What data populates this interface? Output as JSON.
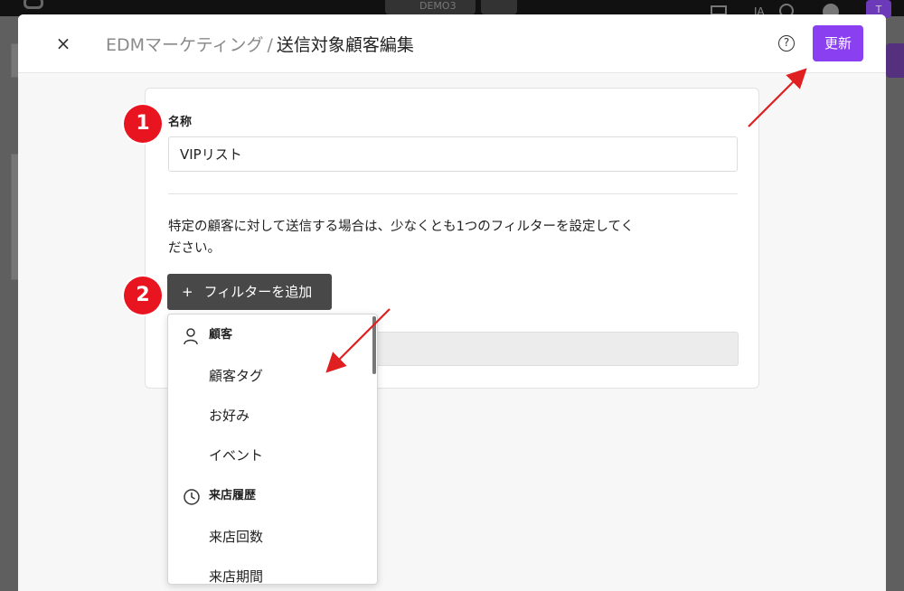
{
  "background": {
    "env_label": "DEMO3",
    "language": "JA",
    "user_initial": "T"
  },
  "modal": {
    "close_label": "×",
    "breadcrumb_parent": "EDMマーケティング",
    "breadcrumb_separator": "/",
    "breadcrumb_current": "送信対象顧客編集",
    "help_label": "?",
    "update_button": "更新"
  },
  "form": {
    "name_label": "名称",
    "name_value": "VIPリスト",
    "help_text": "特定の顧客に対して送信する場合は、少なくとも1つのフィルターを設定してください。",
    "add_filter_plus": "+",
    "add_filter_label": "フィルターを追加"
  },
  "dropdown": {
    "groups": [
      {
        "label": "顧客",
        "icon": "person-icon",
        "items": [
          "顧客タグ",
          "お好み",
          "イベント"
        ]
      },
      {
        "label": "来店履歴",
        "icon": "clock-icon",
        "items": [
          "来店回数",
          "来店期間"
        ]
      }
    ]
  },
  "annotations": {
    "badge_1": "1",
    "badge_2": "2"
  },
  "colors": {
    "accent": "#8a3ff0",
    "badge_red": "#e8141f",
    "arrow_red": "#e02020",
    "button_dark": "#484848"
  }
}
